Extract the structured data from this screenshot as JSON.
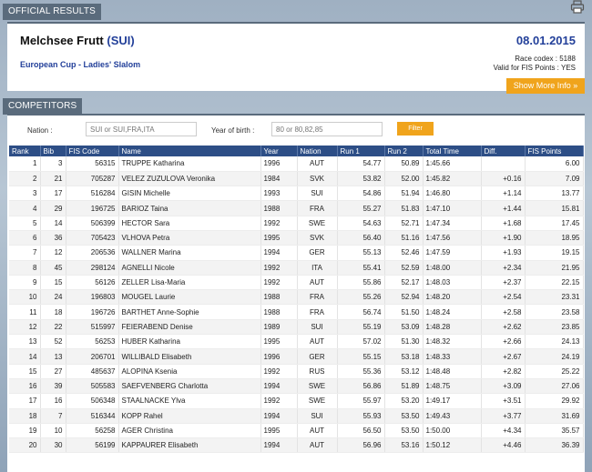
{
  "official_tab": "OFFICIAL RESULTS",
  "competitors_tab": "COMPETITORS",
  "event": {
    "place": "Melchsee Frutt",
    "country": "(SUI)",
    "date": "08.01.2015",
    "subtitle": "European Cup - Ladies' Slalom",
    "race_codex": "Race codex : 5188",
    "fis_valid": "Valid for FIS Points : YES",
    "show_more": "Show More Info »"
  },
  "filters": {
    "nation_label": "Nation :",
    "nation_placeholder": "SUI or SUI,FRA,ITA",
    "year_label": "Year of birth :",
    "year_placeholder": "80 or 80,82,85",
    "filter_button": "Filter"
  },
  "table": {
    "headers": [
      "Rank",
      "Bib",
      "FIS Code",
      "Name",
      "Year",
      "Nation",
      "Run 1",
      "Run 2",
      "Total Time",
      "Diff.",
      "FIS Points"
    ],
    "rows": [
      [
        "1",
        "3",
        "56315",
        "TRUPPE Katharina",
        "1996",
        "AUT",
        "54.77",
        "50.89",
        "1:45.66",
        "",
        "6.00"
      ],
      [
        "2",
        "21",
        "705287",
        "VELEZ ZUZULOVA Veronika",
        "1984",
        "SVK",
        "53.82",
        "52.00",
        "1:45.82",
        "+0.16",
        "7.09"
      ],
      [
        "3",
        "17",
        "516284",
        "GISIN Michelle",
        "1993",
        "SUI",
        "54.86",
        "51.94",
        "1:46.80",
        "+1.14",
        "13.77"
      ],
      [
        "4",
        "29",
        "196725",
        "BARIOZ Taina",
        "1988",
        "FRA",
        "55.27",
        "51.83",
        "1:47.10",
        "+1.44",
        "15.81"
      ],
      [
        "5",
        "14",
        "506399",
        "HECTOR Sara",
        "1992",
        "SWE",
        "54.63",
        "52.71",
        "1:47.34",
        "+1.68",
        "17.45"
      ],
      [
        "6",
        "36",
        "705423",
        "VLHOVA Petra",
        "1995",
        "SVK",
        "56.40",
        "51.16",
        "1:47.56",
        "+1.90",
        "18.95"
      ],
      [
        "7",
        "12",
        "206536",
        "WALLNER Marina",
        "1994",
        "GER",
        "55.13",
        "52.46",
        "1:47.59",
        "+1.93",
        "19.15"
      ],
      [
        "8",
        "45",
        "298124",
        "AGNELLI Nicole",
        "1992",
        "ITA",
        "55.41",
        "52.59",
        "1:48.00",
        "+2.34",
        "21.95"
      ],
      [
        "9",
        "15",
        "56126",
        "ZELLER Lisa-Maria",
        "1992",
        "AUT",
        "55.86",
        "52.17",
        "1:48.03",
        "+2.37",
        "22.15"
      ],
      [
        "10",
        "24",
        "196803",
        "MOUGEL Laurie",
        "1988",
        "FRA",
        "55.26",
        "52.94",
        "1:48.20",
        "+2.54",
        "23.31"
      ],
      [
        "11",
        "18",
        "196726",
        "BARTHET Anne-Sophie",
        "1988",
        "FRA",
        "56.74",
        "51.50",
        "1:48.24",
        "+2.58",
        "23.58"
      ],
      [
        "12",
        "22",
        "515997",
        "FEIERABEND Denise",
        "1989",
        "SUI",
        "55.19",
        "53.09",
        "1:48.28",
        "+2.62",
        "23.85"
      ],
      [
        "13",
        "52",
        "56253",
        "HUBER Katharina",
        "1995",
        "AUT",
        "57.02",
        "51.30",
        "1:48.32",
        "+2.66",
        "24.13"
      ],
      [
        "14",
        "13",
        "206701",
        "WILLIBALD Elisabeth",
        "1996",
        "GER",
        "55.15",
        "53.18",
        "1:48.33",
        "+2.67",
        "24.19"
      ],
      [
        "15",
        "27",
        "485637",
        "ALOPINA Ksenia",
        "1992",
        "RUS",
        "55.36",
        "53.12",
        "1:48.48",
        "+2.82",
        "25.22"
      ],
      [
        "16",
        "39",
        "505583",
        "SAEFVENBERG Charlotta",
        "1994",
        "SWE",
        "56.86",
        "51.89",
        "1:48.75",
        "+3.09",
        "27.06"
      ],
      [
        "17",
        "16",
        "506348",
        "STAALNACKE Ylva",
        "1992",
        "SWE",
        "55.97",
        "53.20",
        "1:49.17",
        "+3.51",
        "29.92"
      ],
      [
        "18",
        "7",
        "516344",
        "KOPP Rahel",
        "1994",
        "SUI",
        "55.93",
        "53.50",
        "1:49.43",
        "+3.77",
        "31.69"
      ],
      [
        "19",
        "10",
        "56258",
        "AGER Christina",
        "1995",
        "AUT",
        "56.50",
        "53.50",
        "1:50.00",
        "+4.34",
        "35.57"
      ],
      [
        "20",
        "30",
        "56199",
        "KAPPAURER Elisabeth",
        "1994",
        "AUT",
        "56.96",
        "53.16",
        "1:50.12",
        "+4.46",
        "36.39"
      ]
    ]
  }
}
